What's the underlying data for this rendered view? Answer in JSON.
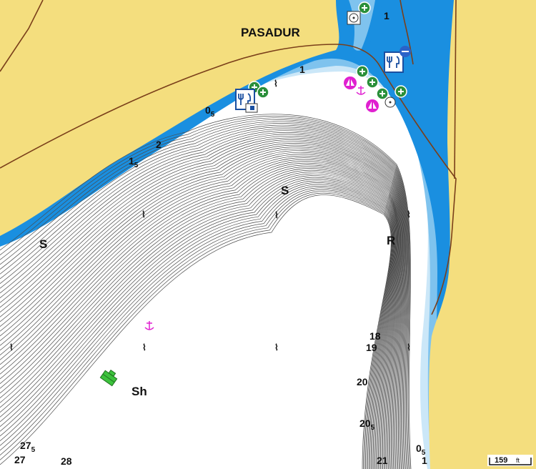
{
  "map": {
    "place_name": "PASADUR",
    "colors": {
      "land": "#f4de7e",
      "shallow_blue": "#1a8fe0",
      "mid_blue": "#7fc3ee",
      "light_blue": "#cbe7f8",
      "deep_water": "#ffffff",
      "contour": "#4a4a4a",
      "road": "#7a3f1a",
      "marker": "#e020d0",
      "marina_green": "#2a8f3a",
      "wreck_green": "#3cc23c"
    },
    "seabed_labels": [
      {
        "id": "s-west",
        "text": "S"
      },
      {
        "id": "s-center",
        "text": "S"
      },
      {
        "id": "r-east",
        "text": "R"
      },
      {
        "id": "sh-south",
        "text": "Sh"
      }
    ],
    "depth_soundings": [
      {
        "id": "d-1-north",
        "main": "1",
        "sub": ""
      },
      {
        "id": "d-1-channel",
        "main": "1",
        "sub": ""
      },
      {
        "id": "d-05-left",
        "main": "0",
        "sub": "5"
      },
      {
        "id": "d-2",
        "main": "2",
        "sub": ""
      },
      {
        "id": "d-15",
        "main": "1",
        "sub": "5"
      },
      {
        "id": "d-18",
        "main": "18",
        "sub": ""
      },
      {
        "id": "d-19",
        "main": "19",
        "sub": ""
      },
      {
        "id": "d-20",
        "main": "20",
        "sub": ""
      },
      {
        "id": "d-205",
        "main": "20",
        "sub": "5"
      },
      {
        "id": "d-21",
        "main": "21",
        "sub": ""
      },
      {
        "id": "d-05-right",
        "main": "0",
        "sub": "5"
      },
      {
        "id": "d-1-right",
        "main": "1",
        "sub": ""
      },
      {
        "id": "d-275",
        "main": "27",
        "sub": "5"
      },
      {
        "id": "d-27",
        "main": "27",
        "sub": ""
      },
      {
        "id": "d-28",
        "main": "28",
        "sub": ""
      }
    ],
    "icons": [
      "restaurant-icon",
      "fuel-icon",
      "marina-plus-icon",
      "harbour-office-icon",
      "sailing-harbour-icon",
      "anchorage-icon",
      "wreck-icon",
      "seaweed-marker-icon"
    ],
    "scale": {
      "value": "159",
      "unit": "ft"
    }
  }
}
